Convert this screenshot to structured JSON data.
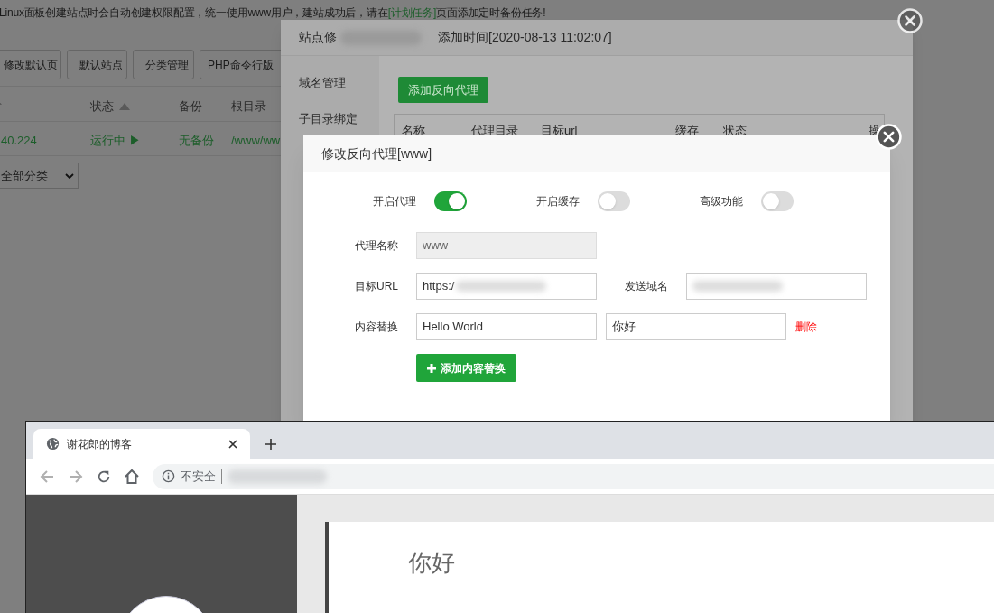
{
  "background_page": {
    "notice": {
      "before": "Linux面板创建站点时会自动创建权限配置，统一使用www用户，建站成功后，请在",
      "link": "[计划任务]",
      "after": "页面添加定时备份任务!"
    },
    "buttons": [
      "修改默认页",
      "默认站点",
      "分类管理",
      "PHP命令行版"
    ],
    "columns": [
      {
        "sort_arrow": true
      },
      {
        "label": "状态",
        "sort_arrow": true
      },
      {
        "label": "备份",
        "sort_arrow": false
      },
      {
        "label": "根目录",
        "sort_arrow": false
      }
    ],
    "rows": [
      {
        "cells": [
          "40.224",
          "运行中 ▶",
          "无备份",
          "/www/ww"
        ]
      }
    ],
    "category_select": "全部分类"
  },
  "site_modal": {
    "title": "站点修",
    "title_redacted": true,
    "added_time": "添加时间[2020-08-13 11:02:07]",
    "sidebar": [
      {
        "label": "域名管理",
        "selected": false
      },
      {
        "label": "子目录绑定",
        "selected": false
      }
    ],
    "add_button": "添加反向代理",
    "columns": [
      "名称",
      "代理目录",
      "目标url",
      "缓存",
      "状态",
      "操"
    ]
  },
  "proxy_modal": {
    "title": "修改反向代理[www]",
    "switches": [
      {
        "label": "开启代理",
        "on": true
      },
      {
        "label": "开启缓存",
        "on": false
      },
      {
        "label": "高级功能",
        "on": false
      }
    ],
    "rows": [
      {
        "fields": [
          {
            "label": "代理名称",
            "value": "www",
            "disabled": true,
            "redacted": false
          }
        ]
      },
      {
        "fields": [
          {
            "label": "目标URL",
            "value": "https:/",
            "disabled": false,
            "redacted": true
          },
          {
            "label": "发送域名",
            "disabled": false,
            "redacted": true
          }
        ]
      }
    ],
    "replace": {
      "label": "内容替换",
      "from": "Hello World",
      "to": "你好",
      "delete": "删除"
    },
    "add_button": "添加内容替换"
  },
  "browser": {
    "tab": {
      "title": "谢花郎的博客",
      "selected": true
    },
    "back_disabled": true,
    "forward_disabled": true,
    "security": "不安全",
    "url_redacted": true,
    "heading": "你好"
  }
}
